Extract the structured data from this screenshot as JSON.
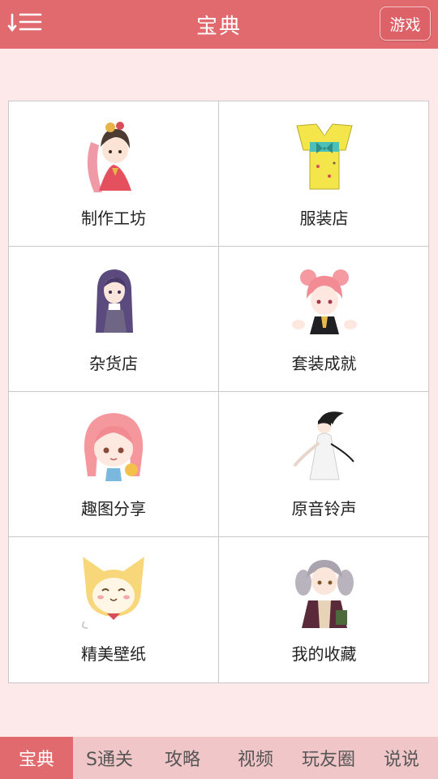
{
  "header": {
    "title": "宝典",
    "game_button": "游戏",
    "menu_icon": "menu-list-icon"
  },
  "colors": {
    "header_bg": "#e16a6f",
    "page_bg": "#fde9ea",
    "tabbar_bg": "#f1c6c8",
    "active_tab_bg": "#e16a6f"
  },
  "grid": {
    "items": [
      {
        "label": "制作工坊",
        "icon": "chinese-costume-girl-illustration"
      },
      {
        "label": "服装店",
        "icon": "yellow-kimono-illustration"
      },
      {
        "label": "杂货店",
        "icon": "purple-hair-girl-illustration"
      },
      {
        "label": "套装成就",
        "icon": "pink-hair-bun-girl-illustration"
      },
      {
        "label": "趣图分享",
        "icon": "pink-hair-chibi-girl-illustration"
      },
      {
        "label": "原音铃声",
        "icon": "white-dress-girl-illustration"
      },
      {
        "label": "精美壁纸",
        "icon": "yellow-cat-illustration"
      },
      {
        "label": "我的收藏",
        "icon": "silver-drill-hair-girl-illustration"
      }
    ]
  },
  "tabs": [
    {
      "label": "宝典",
      "active": true
    },
    {
      "label": "S通关",
      "active": false
    },
    {
      "label": "攻略",
      "active": false
    },
    {
      "label": "视频",
      "active": false
    },
    {
      "label": "玩友圈",
      "active": false
    },
    {
      "label": "说说",
      "active": false
    }
  ]
}
